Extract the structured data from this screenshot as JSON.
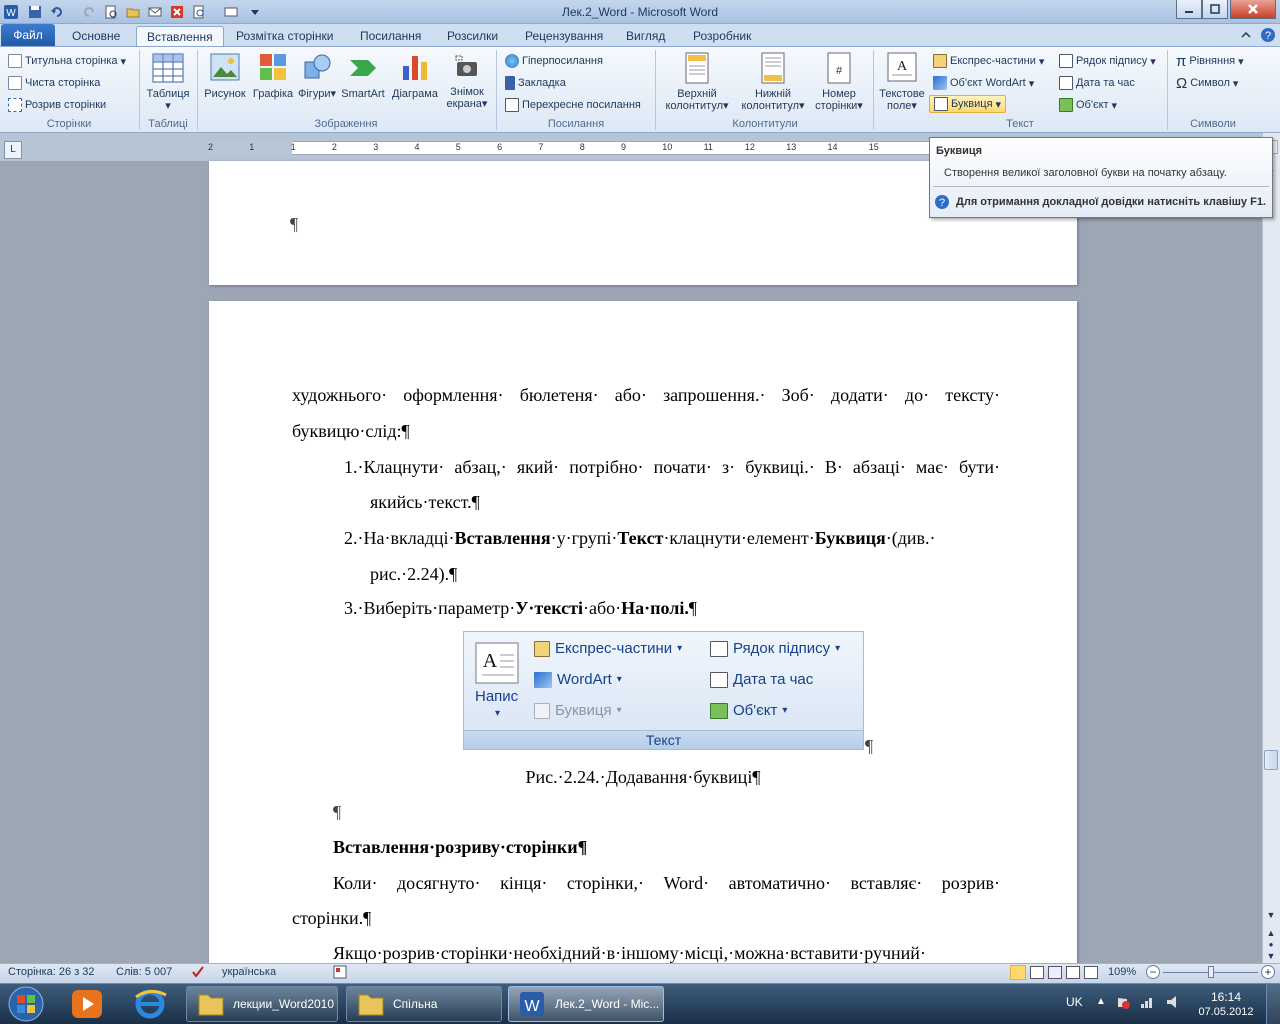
{
  "window": {
    "title": "Лек.2_Word  -  Microsoft Word"
  },
  "tabs": [
    "Файл",
    "Основне",
    "Вставлення",
    "Розмітка сторінки",
    "Посилання",
    "Розсилки",
    "Рецензування",
    "Вигляд",
    "Розробник"
  ],
  "ribbon": {
    "pages": {
      "cover": "Титульна сторінка",
      "blank": "Чиста сторінка",
      "break": "Розрив сторінки",
      "label": "Сторінки"
    },
    "tables": {
      "table": "Таблиця",
      "label": "Таблиці"
    },
    "illustrations": {
      "picture": "Рисунок",
      "clipart": "Графіка",
      "shapes": "Фігури",
      "smartart": "SmartArt",
      "chart": "Діаграма",
      "screenshot_l1": "Знімок",
      "screenshot_l2": "екрана",
      "label": "Зображення"
    },
    "links": {
      "hyperlink": "Гіперпосилання",
      "bookmark": "Закладка",
      "crossref": "Перехресне посилання",
      "label": "Посилання"
    },
    "headerfooter": {
      "header_l1": "Верхній",
      "header_l2": "колонтитул",
      "footer_l1": "Нижній",
      "footer_l2": "колонтитул",
      "pagenum_l1": "Номер",
      "pagenum_l2": "сторінки",
      "label": "Колонтитули"
    },
    "text": {
      "textbox_l1": "Текстове",
      "textbox_l2": "поле",
      "quickparts": "Експрес-частини",
      "wordart": "Об'єкт WordArt",
      "dropcap": "Буквиця",
      "signature": "Рядок підпису",
      "datetime": "Дата та час",
      "object": "Об'єкт",
      "label": "Текст"
    },
    "symbols": {
      "equation": "Рівняння",
      "symbol": "Символ",
      "label": "Символи"
    }
  },
  "tooltip": {
    "title": "Буквиця",
    "description": "Створення великої заголовної букви на початку абзацу.",
    "help": "Для отримання докладної довідки натисніть клавішу F1."
  },
  "document": {
    "pilcrow": "¶",
    "p1_line1": "художнього· оформлення· бюлетеня· або· запрошення.· Зоб· додати· до· тексту·",
    "p1_line2": "буквицю·слід:¶",
    "item1_line1": "1.·Клацнути· абзац,· який· потрібно· почати· з· буквиці.· В· абзаці· має· бути·",
    "item1_line2": "якийсь·текст.¶",
    "item2_a": "2.·На·вкладці·",
    "item2_b": "Вставлення",
    "item2_c": "·у·групі·",
    "item2_d": "Текст",
    "item2_e": "·клацнути·елемент·",
    "item2_f": "Буквиця",
    "item2_g": "·(див.·",
    "item2_line2": "рис.·2.24).¶",
    "item3_a": "3.·Виберіть·параметр·",
    "item3_b": "У·тексті",
    "item3_c": "·або·",
    "item3_d": "На·полі.",
    "item3_e": "¶",
    "caption": "Рис.·2.24.·Додавання·буквиці¶",
    "heading": "Вставлення·розриву·сторінки¶",
    "p2_line1": "Коли· досягнуто· кінця· сторінки,· Word· автоматично· вставляє· розрив·",
    "p2_line2": "сторінки.¶",
    "p3_line1": "Якщо·розрив·сторінки·необхідний·в·іншому·місці,·можна·вставити·ручний·"
  },
  "figure": {
    "caption_btn": "Напис",
    "quickparts": "Експрес-частини",
    "wordart": "WordArt",
    "dropcap": "Буквиця",
    "signature": "Рядок підпису",
    "datetime": "Дата та час",
    "object": "Об'єкт",
    "group": "Текст"
  },
  "ruler": {
    "ticks": [
      "2",
      "1",
      "1",
      "2",
      "3",
      "4",
      "5",
      "6",
      "7",
      "8",
      "9",
      "10",
      "11",
      "12",
      "13",
      "14",
      "15"
    ]
  },
  "status": {
    "page": "Сторінка: 26 з 32",
    "words": "Слів: 5 007",
    "language": "українська",
    "zoom": "109%"
  },
  "taskbar": {
    "task1": "лекции_Word2010",
    "task2": "Спільна",
    "task3": "Лек.2_Word - Mic...",
    "lang": "UK",
    "time": "16:14",
    "date": "07.05.2012"
  },
  "colors": {
    "accent": "#1f5aa8",
    "ribbon": "#dde8f5"
  }
}
